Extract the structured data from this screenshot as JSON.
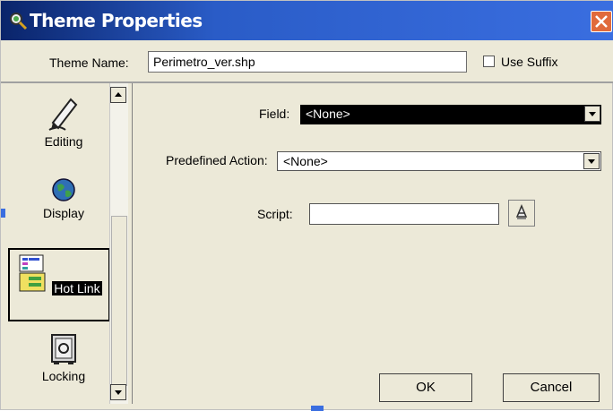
{
  "window": {
    "title": "Theme Properties"
  },
  "theme": {
    "name_label": "Theme Name:",
    "name_value": "Perimetro_ver.shp",
    "use_suffix_label": "Use Suffix",
    "use_suffix_checked": false
  },
  "categories": [
    {
      "label": "Editing",
      "icon": "pencil-icon"
    },
    {
      "label": "Display",
      "icon": "globe-icon"
    },
    {
      "label": "Hot Link",
      "icon": "hotlink-icon",
      "selected": true
    },
    {
      "label": "Locking",
      "icon": "safe-icon"
    }
  ],
  "form": {
    "field_label": "Field:",
    "field_value": "<None>",
    "action_label": "Predefined Action:",
    "action_value": "<None>",
    "script_label": "Script:",
    "script_value": ""
  },
  "buttons": {
    "ok": "OK",
    "cancel": "Cancel"
  },
  "colors": {
    "title_bar": "#2a5cc7",
    "dialog_bg": "#ece9d8",
    "selected_field_bg": "#000000"
  }
}
